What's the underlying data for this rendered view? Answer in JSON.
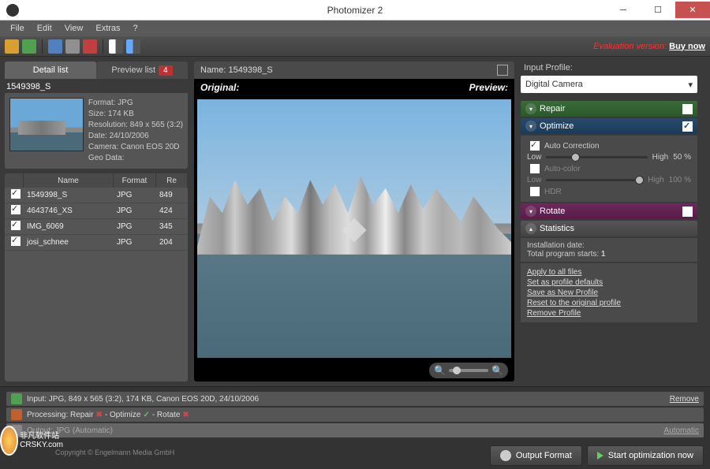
{
  "title": "Photomizer 2",
  "menu": [
    "File",
    "Edit",
    "View",
    "Extras",
    "?"
  ],
  "eval_text": "Evaluation version: ",
  "eval_link": "Buy now",
  "left": {
    "tab_detail": "Detail list",
    "tab_preview": "Preview list",
    "badge": "4",
    "current_file": "1549398_S",
    "meta_format": "Format: JPG",
    "meta_size": "Size: 174 KB",
    "meta_res": "Resolution: 849 x 565 (3:2)",
    "meta_date": "Date: 24/10/2006",
    "meta_camera": "Camera: Canon EOS 20D",
    "meta_geo": "Geo Data:",
    "hdr_name": "Name",
    "hdr_format": "Format",
    "hdr_re": "Re",
    "rows": [
      {
        "name": "1549398_S",
        "format": "JPG",
        "re": "849",
        "chk": true
      },
      {
        "name": "4643746_XS",
        "format": "JPG",
        "re": "424",
        "chk": true
      },
      {
        "name": "IMG_6069",
        "format": "JPG",
        "re": "345",
        "chk": true
      },
      {
        "name": "josi_schnee",
        "format": "JPG",
        "re": "204",
        "chk": true
      }
    ]
  },
  "mid": {
    "name_label": "Name: 1549398_S",
    "original": "Original:",
    "preview": "Preview:"
  },
  "right": {
    "input_profile_label": "Input Profile:",
    "input_profile": "Digital Camera",
    "repair": "Repair",
    "optimize": "Optimize",
    "auto_corr": "Auto Correction",
    "low": "Low",
    "high": "High",
    "pct50": "50 %",
    "auto_color": "Auto-color",
    "pct100": "100 %",
    "hdr": "HDR",
    "rotate": "Rotate",
    "stats": "Statistics",
    "inst_date": "Installation date:",
    "prog_starts": "Total program starts: ",
    "prog_starts_n": "1",
    "link_apply": "Apply to all files",
    "link_setdef": "Set as profile defaults",
    "link_savenew": "Save as New Profile",
    "link_reset": "Reset to the original profile",
    "link_remove": "Remove Profile"
  },
  "bottom": {
    "input_line": "Input: JPG, 849 x 565 (3:2), 174 KB, Canon EOS 20D, 24/10/2006",
    "proc_prefix": "Processing: Repair",
    "proc_mid": " - Optimize",
    "proc_end": " - Rotate",
    "output_line": "Output: JPG (Automatic)",
    "remove": "Remove",
    "automatic": "Automatic",
    "btn_format": "Output Format",
    "btn_start": "Start optimization now"
  },
  "copyright": "Copyright © Engelmann Media GmbH",
  "watermark1": "非凡软件站",
  "watermark2": "CRSKY.com"
}
